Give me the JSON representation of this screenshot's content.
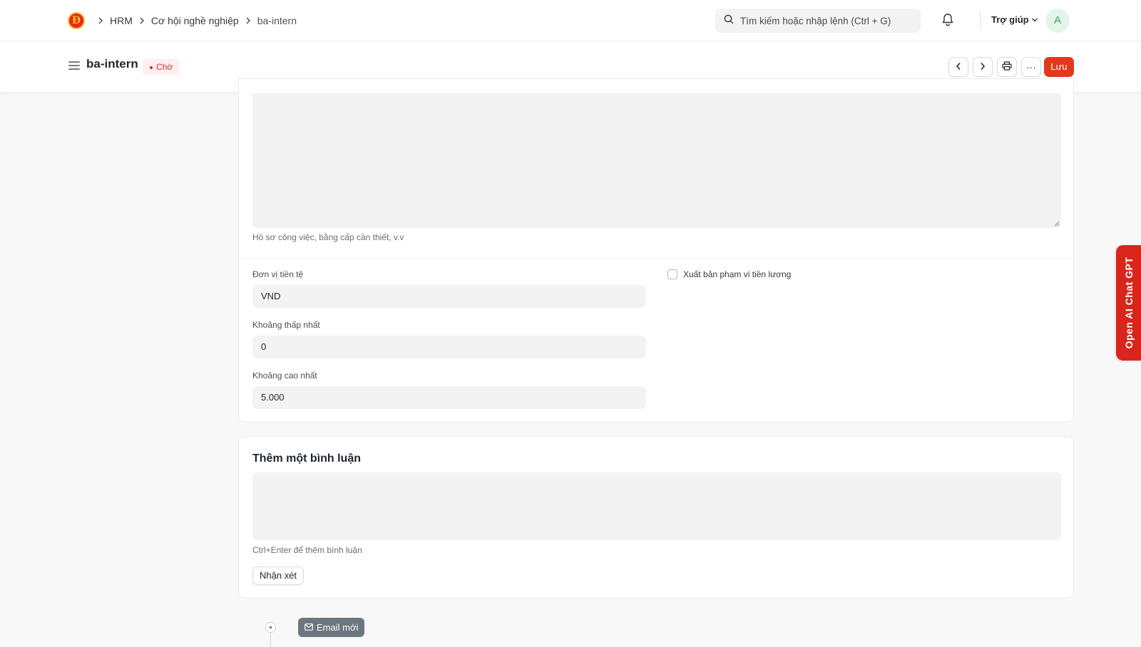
{
  "navbar": {
    "logo_letter": "Đ",
    "breadcrumbs": [
      "HRM",
      "Cơ hội nghề nghiệp",
      "ba-intern"
    ],
    "search_placeholder": "Tìm kiếm hoặc nhập lệnh (Ctrl + G)",
    "help_label": "Trợ giúp",
    "avatar_initial": "A"
  },
  "header": {
    "title": "ba-intern",
    "status": "Chờ",
    "more_label": "···",
    "save_label": "Lưu"
  },
  "form": {
    "description_hint": "Hồ sơ công việc, bằng cấp cần thiết, v.v",
    "currency": {
      "label": "Đơn vị tiền tệ",
      "value": "VND"
    },
    "lower_range": {
      "label": "Khoảng thấp nhất",
      "value": "0"
    },
    "upper_range": {
      "label": "Khoảng cao nhất",
      "value": "5.000"
    },
    "publish_salary": {
      "label": "Xuất bản phạm vi tiền lương",
      "checked": false
    }
  },
  "comment": {
    "title": "Thêm một bình luận",
    "hint": "Ctrl+Enter để thêm bình luận",
    "button_label": "Nhận xét"
  },
  "timeline": {
    "new_email_label": "Email mới"
  },
  "ai_tab": {
    "label": "Open AI Chat GPT"
  },
  "colors": {
    "primary_button": "#e0391b",
    "status_red": "#d42c2c",
    "ai_tab": "#d8261c"
  }
}
